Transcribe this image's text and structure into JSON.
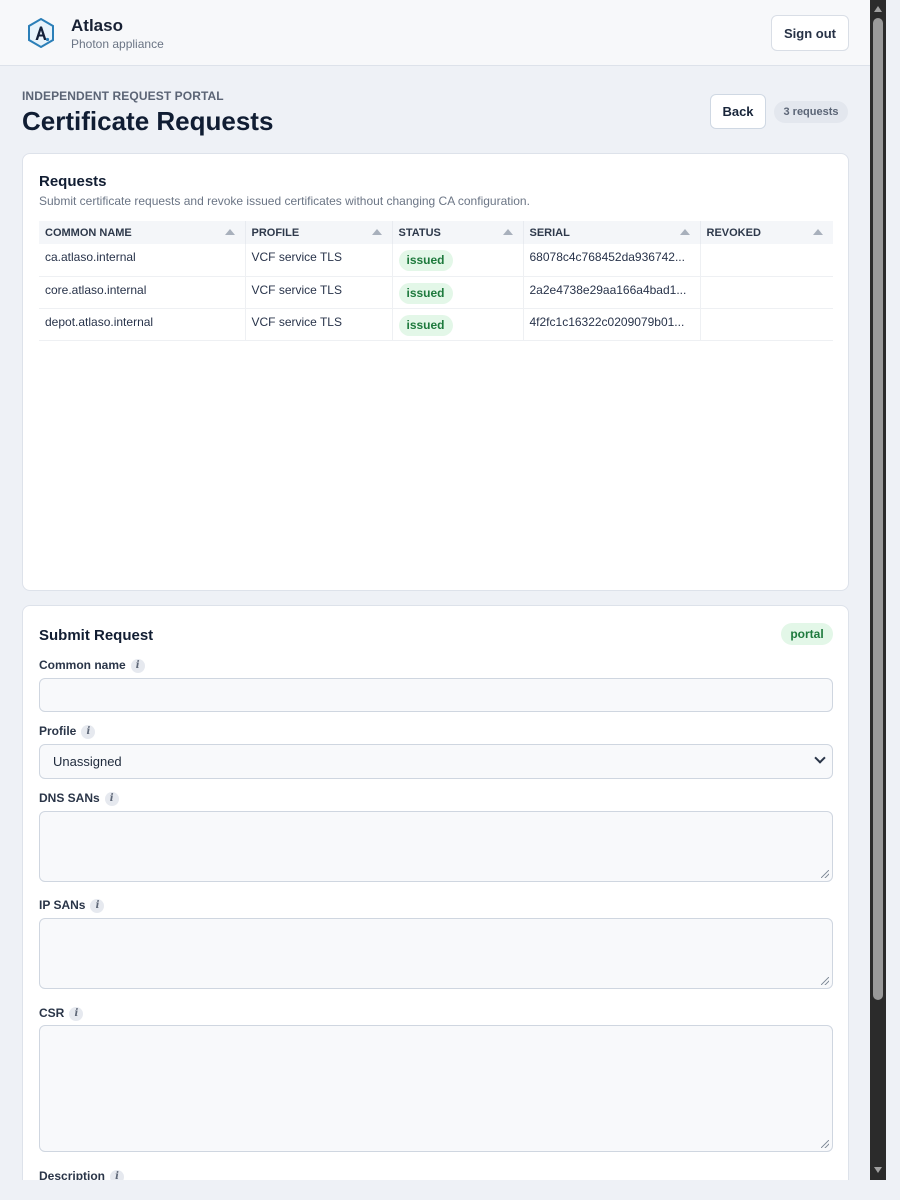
{
  "app": {
    "name": "Atlaso",
    "subtitle": "Photon appliance",
    "sign_out_label": "Sign out"
  },
  "page": {
    "eyebrow": "INDEPENDENT REQUEST PORTAL",
    "title": "Certificate Requests",
    "back_label": "Back",
    "count_label": "3 requests"
  },
  "requests": {
    "title": "Requests",
    "description": "Submit certificate requests and revoke issued certificates without changing CA configuration.",
    "columns": [
      "COMMON NAME",
      "PROFILE",
      "STATUS",
      "SERIAL",
      "REVOKED"
    ],
    "rows": [
      {
        "common_name": "ca.atlaso.internal",
        "profile": "VCF service TLS",
        "status": "issued",
        "serial": "68078c4c768452da936742...",
        "revoked": ""
      },
      {
        "common_name": "core.atlaso.internal",
        "profile": "VCF service TLS",
        "status": "issued",
        "serial": "2a2e4738e29aa166a4bad1...",
        "revoked": ""
      },
      {
        "common_name": "depot.atlaso.internal",
        "profile": "VCF service TLS",
        "status": "issued",
        "serial": "4f2fc1c16322c0209079b01...",
        "revoked": ""
      }
    ]
  },
  "submit": {
    "title": "Submit Request",
    "badge": "portal",
    "info_glyph": "i",
    "fields": {
      "common_name": {
        "label": "Common name",
        "value": ""
      },
      "profile": {
        "label": "Profile",
        "value": "Unassigned"
      },
      "dns_sans": {
        "label": "DNS SANs",
        "value": ""
      },
      "ip_sans": {
        "label": "IP SANs",
        "value": ""
      },
      "csr": {
        "label": "CSR",
        "value": ""
      },
      "description": {
        "label": "Description"
      }
    }
  },
  "colors": {
    "accent": "#1e7a3d",
    "badge_bg": "#e3f7e8",
    "background": "#eef1f6",
    "title": "#101d33"
  },
  "icons": {
    "logo": "atlaso-hexagon-logo",
    "info": "info-icon",
    "sort": "sort-ascending-icon",
    "select": "chevron-down-icon",
    "resize": "resize-grip-icon"
  }
}
